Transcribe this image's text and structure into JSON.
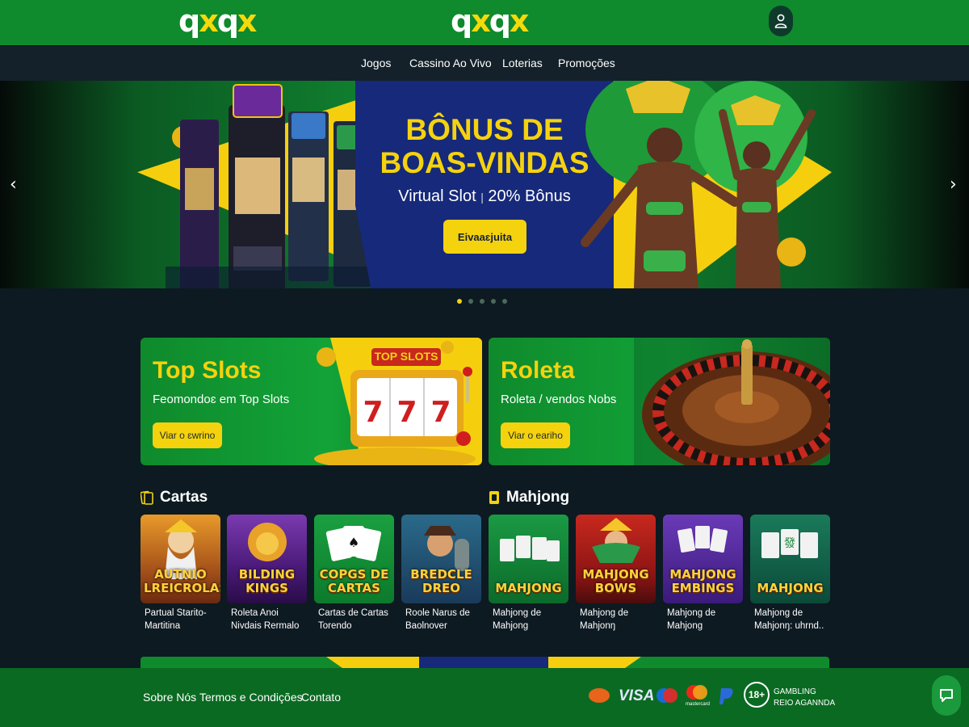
{
  "header": {
    "logo_left": {
      "p1": "q",
      "p2": "x",
      "p3": "q",
      "p4": "x"
    },
    "logo_center": {
      "p1": "q",
      "p2": "x",
      "p3": "q",
      "p4": "x"
    },
    "user_icon": "user-icon"
  },
  "nav": {
    "items": [
      {
        "label": "Jogos"
      },
      {
        "label": "Cassino Ao Vivo"
      },
      {
        "label": "Loterias"
      },
      {
        "label": "Promoções"
      }
    ]
  },
  "hero": {
    "title_line1": "BÔNUS DE",
    "title_line2": "BOAS-VINDAS",
    "subtitle_left": "Virtual Slot",
    "subtitle_right": "20% Bônus",
    "cta_label": "Eivaaɛjuita",
    "prev_arrow": "‹",
    "next_arrow": "›",
    "dots_count": 5,
    "active_dot": 1
  },
  "promos": [
    {
      "title": "Top Slots",
      "subtitle": "Feomondoɛ em Top Slots",
      "button": "Viar o ɛwrino",
      "badge": "TOP SLOTS"
    },
    {
      "title": "Roleta",
      "subtitle": "Roleta / vendos Nobs",
      "button": "Viar o eariho"
    }
  ],
  "sections": {
    "cartas": {
      "title": "Cartas"
    },
    "mahjong": {
      "title": "Mahjong"
    }
  },
  "games": [
    {
      "thumb": "AUTNIO LREICROLAS",
      "title_1": "Partual Starito-",
      "title_2": "Martitina"
    },
    {
      "thumb": "BILDING KINGS",
      "title_1": "Roleta Anoi",
      "title_2": "Nivdais Rermalo"
    },
    {
      "thumb": "COPGS DE CARTAS",
      "title_1": "Cartas de Cartas",
      "title_2": "Torendo"
    },
    {
      "thumb": "BREDCLE DREO",
      "title_1": "Roole Narus de",
      "title_2": "Baolnover"
    },
    {
      "thumb": "MAHJONG",
      "title_1": "Mahjong de",
      "title_2": "Mahjong"
    },
    {
      "thumb": "MAHJONG BOWS",
      "title_1": "Mahjong de",
      "title_2": "Mahjonŋ"
    },
    {
      "thumb": "MAHJONG EMBINGS",
      "title_1": "Mahjong de",
      "title_2": "Mahjong"
    },
    {
      "thumb": "MAHJONG",
      "title_1": "Mahjong de",
      "title_2": "Mahjonŋ: uhrnd.."
    }
  ],
  "footer": {
    "links": [
      {
        "label": "Sobre Nós"
      },
      {
        "label": "Termos e Condições"
      },
      {
        "label": "Contato"
      }
    ],
    "payments": {
      "visa": "VISA",
      "mastercard_caption": "mastercard",
      "age": "18+",
      "gambling_1": "GAMBLING",
      "gambling_2": "REIO AGANNDA"
    }
  },
  "colors": {
    "brand_green": "#0f8a2c",
    "brand_yellow": "#f5d20e",
    "dark_bg": "#0d1a21",
    "nav_bg": "#14212a"
  }
}
